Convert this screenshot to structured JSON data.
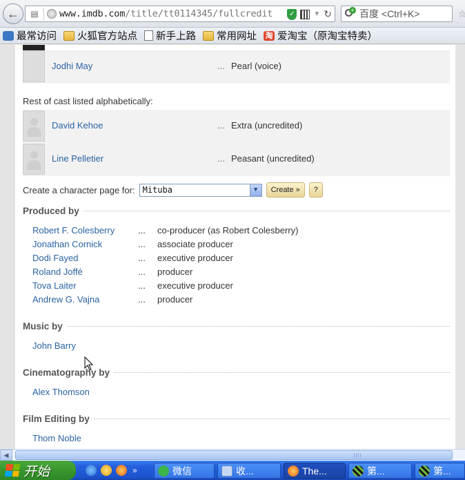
{
  "browser": {
    "url_prefix": "www.imdb.com",
    "url_rest": "/title/tt0114345/fullcredit",
    "search_placeholder": "百度 <Ctrl+K>",
    "icons": [
      "back-arrow-icon",
      "list-icon",
      "globe-icon",
      "shield-icon",
      "qr-code-icon",
      "dropdown-arrow-icon",
      "reload-icon",
      "search-engine-icon",
      "star-icon"
    ]
  },
  "bookmarks": [
    {
      "label": "最常访问",
      "icon": "bookmark-blue-icon"
    },
    {
      "label": "火狐官方站点",
      "icon": "folder-icon"
    },
    {
      "label": "新手上路",
      "icon": "page-icon"
    },
    {
      "label": "常用网址",
      "icon": "folder-icon"
    },
    {
      "label": "爱淘宝（原淘宝特卖）",
      "icon": "taobao-icon"
    }
  ],
  "cast": {
    "top_rows": [
      {
        "name": "Jodhi May",
        "dots": "...",
        "character": "Pearl (voice)"
      }
    ],
    "rest_label": "Rest of cast listed alphabetically:",
    "rest_rows": [
      {
        "name": "David Kehoe",
        "dots": "...",
        "character": "Extra (uncredited)"
      },
      {
        "name": "Line Pelletier",
        "dots": "...",
        "character": "Peasant (uncredited)"
      }
    ]
  },
  "character_page": {
    "label": "Create a character page for:",
    "selected": "Mituba",
    "create_label": "Create »",
    "help_label": "?"
  },
  "sections": {
    "produced_by": {
      "title": "Produced by",
      "rows": [
        {
          "name": "Robert F. Colesberry",
          "dots": "...",
          "credit": "co-producer (as Robert Colesberry)"
        },
        {
          "name": "Jonathan Cornick",
          "dots": "...",
          "credit": "associate producer"
        },
        {
          "name": "Dodi Fayed",
          "dots": "...",
          "credit": "executive producer"
        },
        {
          "name": "Roland Joffé",
          "dots": "...",
          "credit": "producer"
        },
        {
          "name": "Tova Laiter",
          "dots": "...",
          "credit": "executive producer"
        },
        {
          "name": "Andrew G. Vajna",
          "dots": "...",
          "credit": "producer"
        }
      ]
    },
    "music_by": {
      "title": "Music by",
      "rows": [
        {
          "name": "John Barry"
        }
      ]
    },
    "cinematography_by": {
      "title": "Cinematography by",
      "rows": [
        {
          "name": "Alex Thomson"
        }
      ]
    },
    "film_editing_by": {
      "title": "Film Editing by",
      "rows": [
        {
          "name": "Thom Noble"
        }
      ]
    }
  },
  "taskbar": {
    "start_label": "开始",
    "quick_launch_chevron": "»",
    "tasks": [
      {
        "label": "微信",
        "icon": "wechat-icon"
      },
      {
        "label": "收...",
        "icon": "mail-icon"
      },
      {
        "label": "The...",
        "icon": "firefox-icon",
        "active": true
      },
      {
        "label": "第...",
        "icon": "document-icon"
      },
      {
        "label": "第...",
        "icon": "document-icon"
      }
    ]
  }
}
